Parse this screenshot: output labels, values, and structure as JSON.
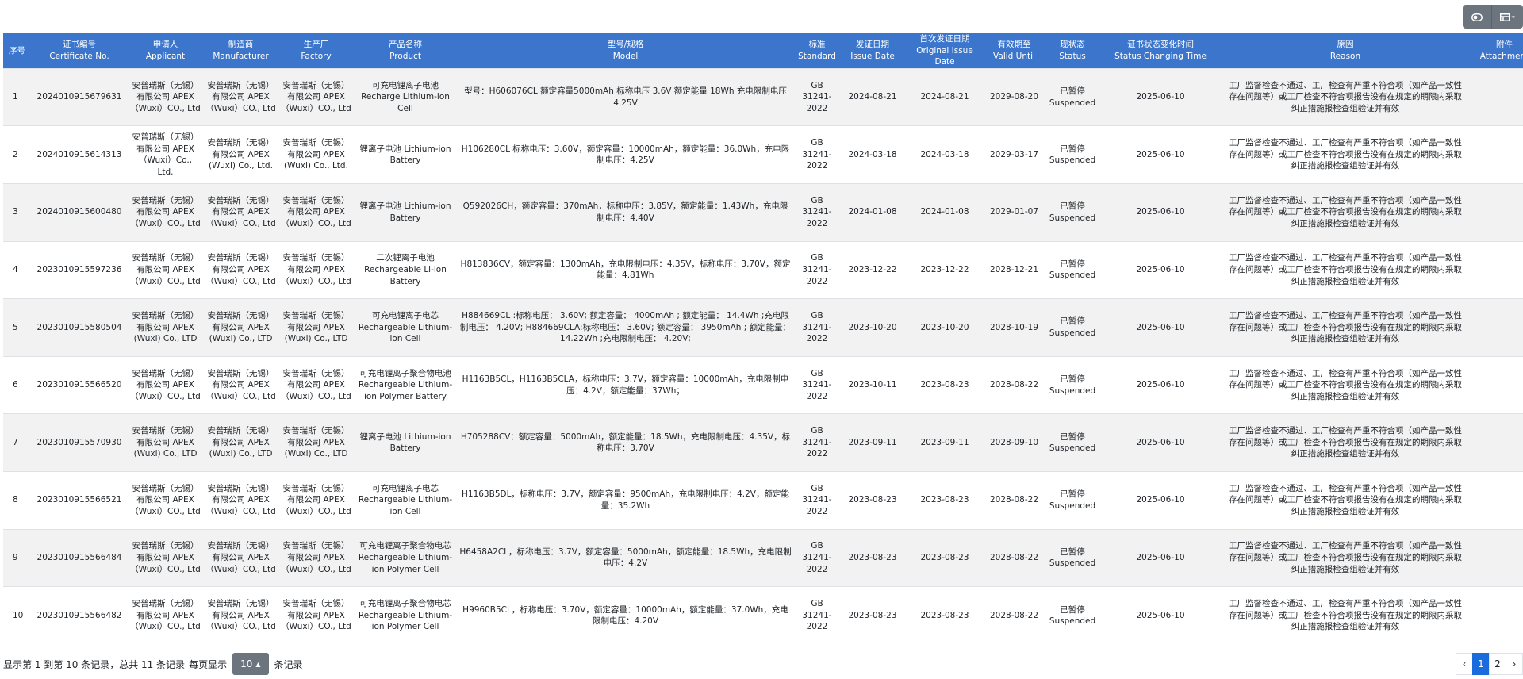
{
  "toolbar": {
    "buttons": [
      {
        "icon": "toggle-icon"
      },
      {
        "icon": "columns-icon"
      }
    ]
  },
  "table": {
    "columns": [
      {
        "zh": "序号",
        "en": ""
      },
      {
        "zh": "证书编号",
        "en": "Certificate No."
      },
      {
        "zh": "申请人",
        "en": "Applicant"
      },
      {
        "zh": "制造商",
        "en": "Manufacturer"
      },
      {
        "zh": "生产厂",
        "en": "Factory"
      },
      {
        "zh": "产品名称",
        "en": "Product"
      },
      {
        "zh": "型号/规格",
        "en": "Model"
      },
      {
        "zh": "标准",
        "en": "Standard"
      },
      {
        "zh": "发证日期",
        "en": "Issue Date"
      },
      {
        "zh": "首次发证日期",
        "en": "Original Issue Date"
      },
      {
        "zh": "有效期至",
        "en": "Valid Until"
      },
      {
        "zh": "现状态",
        "en": "Status"
      },
      {
        "zh": "证书状态变化时间",
        "en": "Status Changing Time"
      },
      {
        "zh": "原因",
        "en": "Reason"
      },
      {
        "zh": "附件",
        "en": "Attachment"
      }
    ],
    "rows": [
      {
        "no": "1",
        "cert": "2024010915679631",
        "applicant": "安普瑞斯（无锡）有限公司 APEX（Wuxi）CO., Ltd",
        "manufacturer": "安普瑞斯（无锡）有限公司 APEX（Wuxi）CO., Ltd",
        "factory": "安普瑞斯（无锡）有限公司 APEX（Wuxi）CO., Ltd",
        "product": "可充电锂离子电池 Recharge Lithium-ion Cell",
        "model": "型号：H606076CL 额定容量5000mAh 标称电压 3.6V 额定能量 18Wh 充电限制电压 4.25V",
        "standard": "GB 31241-2022",
        "issue": "2024-08-21",
        "original": "2024-08-21",
        "valid": "2029-08-20",
        "status": "已暂停 Suspended",
        "change": "2025-06-10",
        "reason": "工厂监督检查不通过、工厂检查有严重不符合项（如产品一致性存在问题等）或工厂检查不符合项报告没有在规定的期限内采取纠正措施报检查组验证并有效"
      },
      {
        "no": "2",
        "cert": "2024010915614313",
        "applicant": "安普瑞斯（无锡）有限公司 APEX（Wuxi）Co., Ltd.",
        "manufacturer": "安普瑞斯（无锡）有限公司 APEX (Wuxi) Co., Ltd.",
        "factory": "安普瑞斯（无锡）有限公司 APEX (Wuxi) Co., Ltd.",
        "product": "锂离子电池 Lithium-ion Battery",
        "model": "H106280CL 标称电压：3.60V，额定容量：10000mAh，额定能量：36.0Wh，充电限制电压：4.25V",
        "standard": "GB 31241-2022",
        "issue": "2024-03-18",
        "original": "2024-03-18",
        "valid": "2029-03-17",
        "status": "已暂停 Suspended",
        "change": "2025-06-10",
        "reason": "工厂监督检查不通过、工厂检查有严重不符合项（如产品一致性存在问题等）或工厂检查不符合项报告没有在规定的期限内采取纠正措施报检查组验证并有效"
      },
      {
        "no": "3",
        "cert": "2024010915600480",
        "applicant": "安普瑞斯（无锡）有限公司 APEX（Wuxi）CO., Ltd",
        "manufacturer": "安普瑞斯（无锡）有限公司 APEX（Wuxi）CO., Ltd",
        "factory": "安普瑞斯（无锡）有限公司 APEX（Wuxi）CO., Ltd",
        "product": "锂离子电池 Lithium-ion Battery",
        "model": "Q592026CH，额定容量：370mAh，标称电压：3.85V，额定能量：1.43Wh，充电限制电压：4.40V",
        "standard": "GB 31241-2022",
        "issue": "2024-01-08",
        "original": "2024-01-08",
        "valid": "2029-01-07",
        "status": "已暂停 Suspended",
        "change": "2025-06-10",
        "reason": "工厂监督检查不通过、工厂检查有严重不符合项（如产品一致性存在问题等）或工厂检查不符合项报告没有在规定的期限内采取纠正措施报检查组验证并有效"
      },
      {
        "no": "4",
        "cert": "2023010915597236",
        "applicant": "安普瑞斯（无锡）有限公司 APEX（Wuxi）CO., Ltd",
        "manufacturer": "安普瑞斯（无锡）有限公司 APEX（Wuxi）CO., Ltd",
        "factory": "安普瑞斯（无锡）有限公司 APEX（Wuxi）CO., Ltd",
        "product": "二次锂离子电池 Rechargeable Li-ion Battery",
        "model": "H813836CV，额定容量：1300mAh，充电限制电压：4.35V，标称电压：3.70V，额定能量：4.81Wh",
        "standard": "GB 31241-2022",
        "issue": "2023-12-22",
        "original": "2023-12-22",
        "valid": "2028-12-21",
        "status": "已暂停 Suspended",
        "change": "2025-06-10",
        "reason": "工厂监督检查不通过、工厂检查有严重不符合项（如产品一致性存在问题等）或工厂检查不符合项报告没有在规定的期限内采取纠正措施报检查组验证并有效"
      },
      {
        "no": "5",
        "cert": "2023010915580504",
        "applicant": "安普瑞斯（无锡）有限公司 APEX (Wuxi) Co., LTD",
        "manufacturer": "安普瑞斯（无锡）有限公司 APEX (Wuxi) Co., LTD",
        "factory": "安普瑞斯（无锡）有限公司 APEX (Wuxi) Co., LTD",
        "product": "可充电锂离子电芯 Rechargeable Lithium-ion Cell",
        "model": "H884669CL :标称电压： 3.60V; 额定容量： 4000mAh ; 额定能量： 14.4Wh ;充电限制电压： 4.20V; H884669CLA:标称电压： 3.60V; 额定容量： 3950mAh ; 额定能量： 14.22Wh ;充电限制电压： 4.20V;",
        "standard": "GB 31241-2022",
        "issue": "2023-10-20",
        "original": "2023-10-20",
        "valid": "2028-10-19",
        "status": "已暂停 Suspended",
        "change": "2025-06-10",
        "reason": "工厂监督检查不通过、工厂检查有严重不符合项（如产品一致性存在问题等）或工厂检查不符合项报告没有在规定的期限内采取纠正措施报检查组验证并有效"
      },
      {
        "no": "6",
        "cert": "2023010915566520",
        "applicant": "安普瑞斯（无锡）有限公司 APEX（Wuxi）CO., Ltd",
        "manufacturer": "安普瑞斯（无锡）有限公司 APEX（Wuxi）CO., Ltd",
        "factory": "安普瑞斯（无锡）有限公司 APEX（Wuxi）CO., Ltd",
        "product": "可充电锂离子聚合物电池 Rechargeable Lithium-ion Polymer Battery",
        "model": "H1163B5CL，H1163B5CLA，标称电压：3.7V，额定容量：10000mAh，充电限制电压：4.2V，额定能量：37Wh；",
        "standard": "GB 31241-2022",
        "issue": "2023-10-11",
        "original": "2023-08-23",
        "valid": "2028-08-22",
        "status": "已暂停 Suspended",
        "change": "2025-06-10",
        "reason": "工厂监督检查不通过、工厂检查有严重不符合项（如产品一致性存在问题等）或工厂检查不符合项报告没有在规定的期限内采取纠正措施报检查组验证并有效"
      },
      {
        "no": "7",
        "cert": "2023010915570930",
        "applicant": "安普瑞斯（无锡）有限公司 APEX (Wuxi) Co., LTD",
        "manufacturer": "安普瑞斯（无锡）有限公司 APEX (Wuxi) Co., LTD",
        "factory": "安普瑞斯（无锡）有限公司 APEX (Wuxi) Co., LTD",
        "product": "锂离子电池 Lithium-ion Battery",
        "model": "H705288CV：额定容量：5000mAh，额定能量：18.5Wh，充电限制电压：4.35V，标称电压：3.70V",
        "standard": "GB 31241-2022",
        "issue": "2023-09-11",
        "original": "2023-09-11",
        "valid": "2028-09-10",
        "status": "已暂停 Suspended",
        "change": "2025-06-10",
        "reason": "工厂监督检查不通过、工厂检查有严重不符合项（如产品一致性存在问题等）或工厂检查不符合项报告没有在规定的期限内采取纠正措施报检查组验证并有效"
      },
      {
        "no": "8",
        "cert": "2023010915566521",
        "applicant": "安普瑞斯（无锡）有限公司 APEX（Wuxi）CO., Ltd",
        "manufacturer": "安普瑞斯（无锡）有限公司 APEX（Wuxi）CO., Ltd",
        "factory": "安普瑞斯（无锡）有限公司 APEX（Wuxi）CO., Ltd",
        "product": "可充电锂离子电芯 Rechargeable Lithium-ion Cell",
        "model": "H1163B5DL，标称电压：3.7V，额定容量：9500mAh，充电限制电压：4.2V，额定能量：35.2Wh",
        "standard": "GB 31241-2022",
        "issue": "2023-08-23",
        "original": "2023-08-23",
        "valid": "2028-08-22",
        "status": "已暂停 Suspended",
        "change": "2025-06-10",
        "reason": "工厂监督检查不通过、工厂检查有严重不符合项（如产品一致性存在问题等）或工厂检查不符合项报告没有在规定的期限内采取纠正措施报检查组验证并有效"
      },
      {
        "no": "9",
        "cert": "2023010915566484",
        "applicant": "安普瑞斯（无锡）有限公司 APEX（Wuxi）CO., Ltd",
        "manufacturer": "安普瑞斯（无锡）有限公司 APEX（Wuxi）CO., Ltd",
        "factory": "安普瑞斯（无锡）有限公司 APEX（Wuxi）CO., Ltd",
        "product": "可充电锂离子聚合物电芯 Rechargeable Lithium-ion Polymer Cell",
        "model": "H6458A2CL，标称电压：3.7V，额定容量：5000mAh，额定能量：18.5Wh，充电限制电压：4.2V",
        "standard": "GB 31241-2022",
        "issue": "2023-08-23",
        "original": "2023-08-23",
        "valid": "2028-08-22",
        "status": "已暂停 Suspended",
        "change": "2025-06-10",
        "reason": "工厂监督检查不通过、工厂检查有严重不符合项（如产品一致性存在问题等）或工厂检查不符合项报告没有在规定的期限内采取纠正措施报检查组验证并有效"
      },
      {
        "no": "10",
        "cert": "2023010915566482",
        "applicant": "安普瑞斯（无锡）有限公司 APEX（Wuxi）CO., Ltd",
        "manufacturer": "安普瑞斯（无锡）有限公司 APEX（Wuxi）CO., Ltd",
        "factory": "安普瑞斯（无锡）有限公司 APEX（Wuxi）CO., Ltd",
        "product": "可充电锂离子聚合物电芯 Rechargeable Lithium-ion Polymer Cell",
        "model": "H9960B5CL，标称电压：3.70V，额定容量：10000mAh，额定能量：37.0Wh，充电限制电压：4.20V",
        "standard": "GB 31241-2022",
        "issue": "2023-08-23",
        "original": "2023-08-23",
        "valid": "2028-08-22",
        "status": "已暂停 Suspended",
        "change": "2025-06-10",
        "reason": "工厂监督检查不通过、工厂检查有严重不符合项（如产品一致性存在问题等）或工厂检查不符合项报告没有在规定的期限内采取纠正措施报检查组验证并有效"
      }
    ]
  },
  "footer": {
    "info_prefix": "显示第 1 到第 10 条记录，总共 11 条记录",
    "per_page_label": "每页显示",
    "page_size": "10",
    "records_suffix": "条记录",
    "pagination": {
      "prev": "‹",
      "pages": [
        "1",
        "2"
      ],
      "next": "›",
      "current": "1"
    }
  },
  "colors": {
    "header": "#3c76cc",
    "page_size_button": "#6c757d",
    "active_page": "#1a6bdc"
  }
}
